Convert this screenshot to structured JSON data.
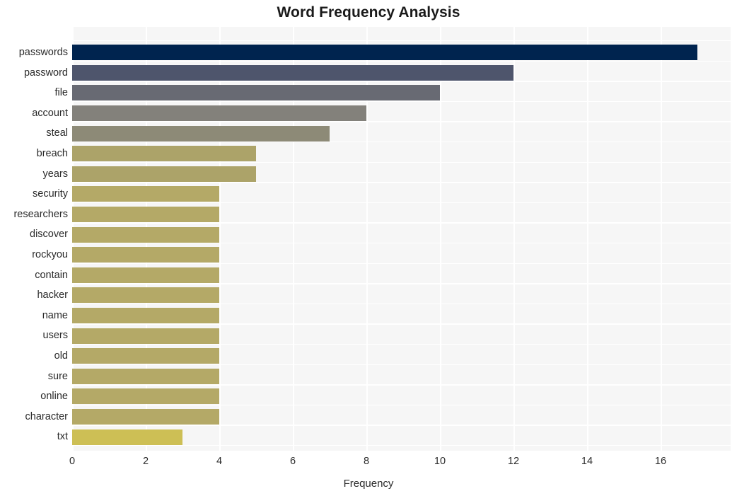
{
  "chart_data": {
    "type": "bar",
    "orientation": "horizontal",
    "title": "Word Frequency Analysis",
    "xlabel": "Frequency",
    "ylabel": "",
    "categories": [
      "passwords",
      "password",
      "file",
      "account",
      "steal",
      "breach",
      "years",
      "security",
      "researchers",
      "discover",
      "rockyou",
      "contain",
      "hacker",
      "name",
      "users",
      "old",
      "sure",
      "online",
      "character",
      "txt"
    ],
    "values": [
      17,
      12,
      10,
      8,
      7,
      5,
      5,
      4,
      4,
      4,
      4,
      4,
      4,
      4,
      4,
      4,
      4,
      4,
      4,
      3
    ],
    "bar_colors": [
      "#00244f",
      "#4e556c",
      "#686a73",
      "#83817b",
      "#8d8a77",
      "#aca369",
      "#aca369",
      "#b4a967",
      "#b4a967",
      "#b4a967",
      "#b4a967",
      "#b4a967",
      "#b4a967",
      "#b4a967",
      "#b4a967",
      "#b4a967",
      "#b4a967",
      "#b4a967",
      "#b4a967",
      "#cdbf55"
    ],
    "xlim": [
      0,
      17.9
    ],
    "xticks": [
      0,
      2,
      4,
      6,
      8,
      10,
      12,
      14,
      16
    ],
    "xtick_labels": [
      "0",
      "2",
      "4",
      "6",
      "8",
      "10",
      "12",
      "14",
      "16"
    ],
    "grid": true,
    "grid_axis": "both",
    "grid_color": "#ffffff",
    "plot_background": "#f6f6f6",
    "figure_background": "#ffffff",
    "legend": null,
    "colormap": "cividis"
  }
}
